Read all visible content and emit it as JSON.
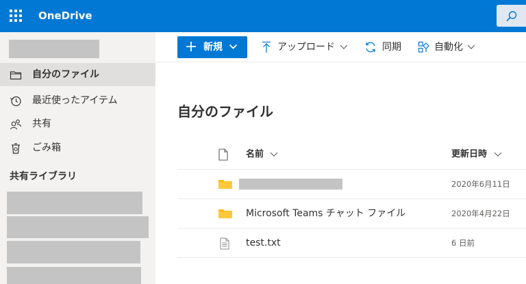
{
  "app": {
    "brand": "OneDrive"
  },
  "sidebar": {
    "items": [
      {
        "label": "自分のファイル",
        "icon": "folder-icon"
      },
      {
        "label": "最近使ったアイテム",
        "icon": "history-icon"
      },
      {
        "label": "共有",
        "icon": "people-icon"
      },
      {
        "label": "ごみ箱",
        "icon": "recycle-bin-icon"
      }
    ],
    "shared_libraries_title": "共有ライブラリ"
  },
  "commandbar": {
    "new_label": "新規",
    "upload_label": "アップロード",
    "sync_label": "同期",
    "automate_label": "自動化"
  },
  "main": {
    "title": "自分のファイル",
    "columns": {
      "name": "名前",
      "modified": "更新日時"
    },
    "rows": [
      {
        "name": "",
        "date": "2020年6月11日",
        "type": "folder"
      },
      {
        "name": "Microsoft Teams チャット ファイル",
        "date": "2020年4月22日",
        "type": "folder"
      },
      {
        "name": "test.txt",
        "date": "6 日前",
        "type": "file"
      }
    ]
  },
  "colors": {
    "brand": "#0078d4",
    "sidebar": "#f3f2f1",
    "folder": "#ffb900"
  }
}
